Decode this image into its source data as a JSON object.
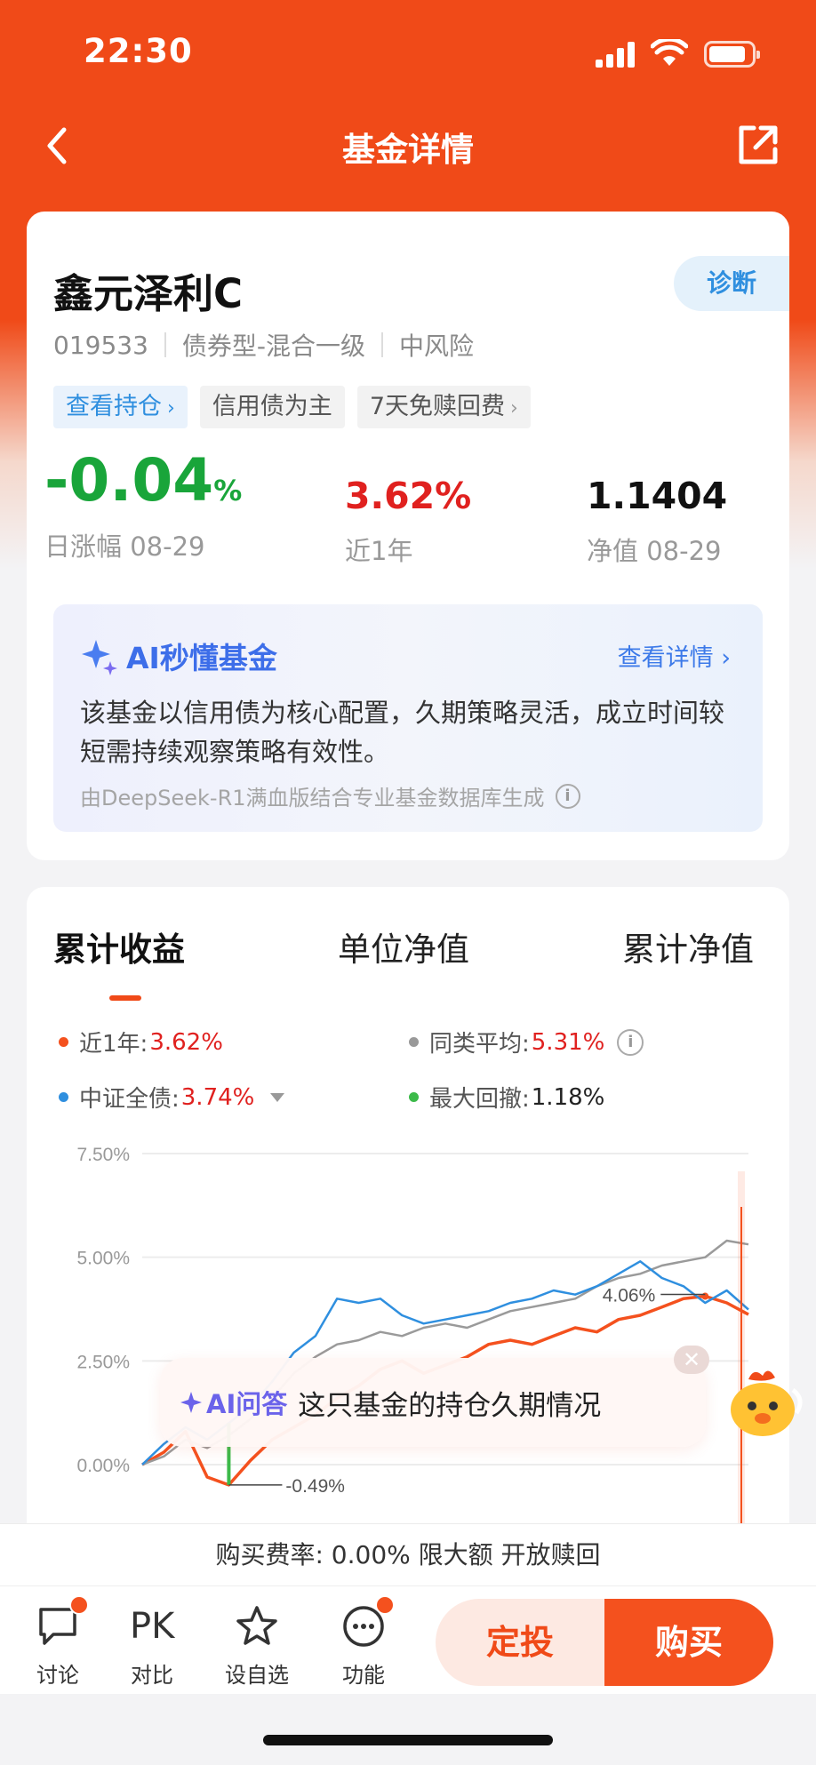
{
  "status": {
    "time": "22:30"
  },
  "nav": {
    "title": "基金详情"
  },
  "fund": {
    "name": "鑫元泽利C",
    "code": "019533",
    "type": "债券型-混合一级",
    "risk": "中风险",
    "diagnose_label": "诊断",
    "tags": [
      "查看持仓",
      "信用债为主",
      "7天免赎回费"
    ],
    "daily_change": "-0.04",
    "daily_change_unit": "%",
    "daily_change_label": "日涨幅 08-29",
    "year_return": "3.62%",
    "year_return_label": "近1年",
    "nav_value": "1.1404",
    "nav_label": "净值 08-29"
  },
  "ai_summary": {
    "title": "AI秒懂基金",
    "more": "查看详情",
    "text": "该基金以信用债为核心配置，久期策略灵活，成立时间较短需持续观察策略有效性。",
    "source": "由DeepSeek-R1满血版结合专业基金数据库生成"
  },
  "chart_tabs": [
    "累计收益",
    "单位净值",
    "累计净值"
  ],
  "legend": [
    {
      "label": "近1年:",
      "value": "3.62%",
      "color": "#f4511e"
    },
    {
      "label": "同类平均:",
      "value": "5.31%",
      "color": "#999999"
    },
    {
      "label": "中证全债:",
      "value": "3.74%",
      "color": "#2f8fdf"
    },
    {
      "label": "最大回撤:",
      "value": "1.18%",
      "color": "#3cba4a"
    }
  ],
  "chart_data": {
    "type": "line",
    "yticks": [
      "7.50%",
      "5.00%",
      "2.50%",
      "0.00%"
    ],
    "ylim": [
      -1.0,
      7.5
    ],
    "annotations": [
      "4.06%",
      "-0.49%"
    ],
    "series": [
      {
        "name": "近1年",
        "color": "#f4511e",
        "values": [
          0.0,
          0.3,
          0.8,
          -0.3,
          -0.49,
          0.1,
          0.6,
          0.9,
          1.2,
          1.6,
          1.9,
          2.3,
          2.5,
          2.2,
          2.4,
          2.6,
          2.9,
          3.0,
          2.9,
          3.1,
          3.3,
          3.2,
          3.5,
          3.6,
          3.8,
          4.0,
          4.06,
          3.9,
          3.62
        ]
      },
      {
        "name": "同类平均",
        "color": "#9a9a9a",
        "values": [
          0.0,
          0.2,
          0.6,
          0.4,
          0.7,
          1.1,
          1.6,
          2.2,
          2.6,
          2.9,
          3.0,
          3.2,
          3.1,
          3.3,
          3.4,
          3.3,
          3.5,
          3.7,
          3.8,
          3.9,
          4.0,
          4.3,
          4.5,
          4.6,
          4.8,
          4.9,
          5.0,
          5.4,
          5.31
        ]
      },
      {
        "name": "中证全债",
        "color": "#2f8fdf",
        "values": [
          0.0,
          0.5,
          0.9,
          0.6,
          1.0,
          1.4,
          2.0,
          2.7,
          3.1,
          4.0,
          3.9,
          4.0,
          3.6,
          3.4,
          3.5,
          3.6,
          3.7,
          3.9,
          4.0,
          4.2,
          4.1,
          4.3,
          4.6,
          4.9,
          4.5,
          4.3,
          3.9,
          4.2,
          3.74
        ]
      }
    ]
  },
  "ai_ask": {
    "brand": "AI问答",
    "question": "这只基金的持仓久期情况"
  },
  "fee_line": "购买费率: 0.00% 限大额 开放赎回",
  "bottom": {
    "items": [
      "讨论",
      "对比",
      "设自选",
      "功能"
    ],
    "pk": "PK",
    "dingtou": "定投",
    "buy": "购买"
  }
}
